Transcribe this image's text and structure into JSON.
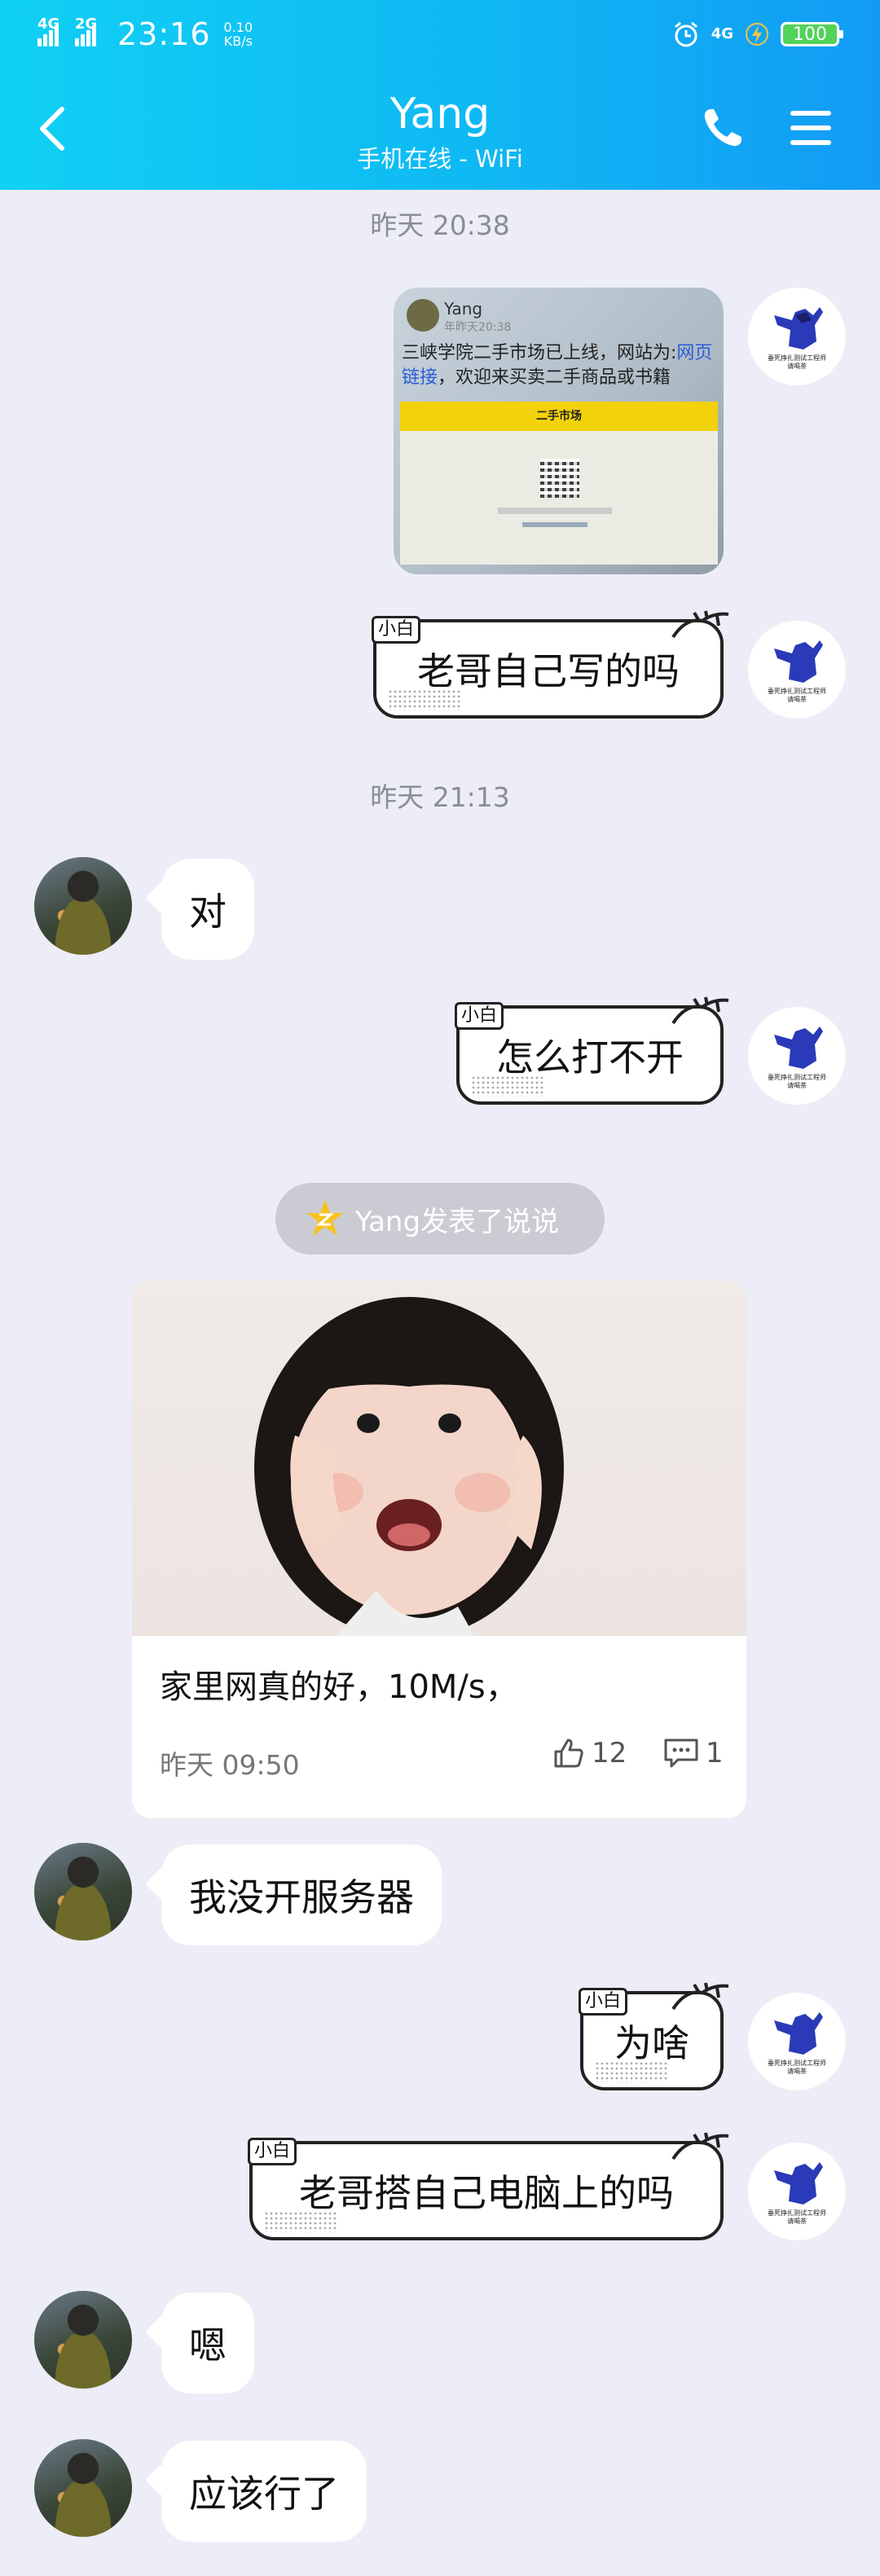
{
  "status_bar": {
    "net_left_1": "4G",
    "net_left_2": "2G",
    "time": "23:16",
    "speed_value": "0.10",
    "speed_unit": "KB/s",
    "net_right": "4G",
    "battery": "100"
  },
  "header": {
    "title": "Yang",
    "subtitle": "手机在线 - WiFi"
  },
  "messages": {
    "ts1": "昨天 20:38",
    "shared_image": {
      "author": "Yang",
      "date": "年昨天20:38",
      "text_before": "三峡学院二手市场已上线，网站为:",
      "link": "网页链接",
      "text_after": "，欢迎来买卖二手商品或书籍",
      "banner": "二手市场"
    },
    "m1": "老哥自己写的吗",
    "ts2": "昨天 21:13",
    "m2": "对",
    "m3": "怎么打不开",
    "feed_notice": "Yang发表了说说",
    "feed": {
      "text": "家里网真的好，10M/s，",
      "date": "昨天 09:50",
      "likes": "12",
      "comments": "1"
    },
    "m4": "我没开服务器",
    "m5": "为啥",
    "m6": "老哥搭自己电脑上的吗",
    "m7": "嗯",
    "m8": "应该行了"
  },
  "bubble_tag": "小白",
  "my_avatar_caption": "垂死挣扎测试工程师\n请喝茶",
  "colors": {
    "header_gradient_start": "#10D0F4",
    "header_gradient_end": "#129BF5",
    "background": "#ECEDF6",
    "battery_green": "#52D35A"
  }
}
